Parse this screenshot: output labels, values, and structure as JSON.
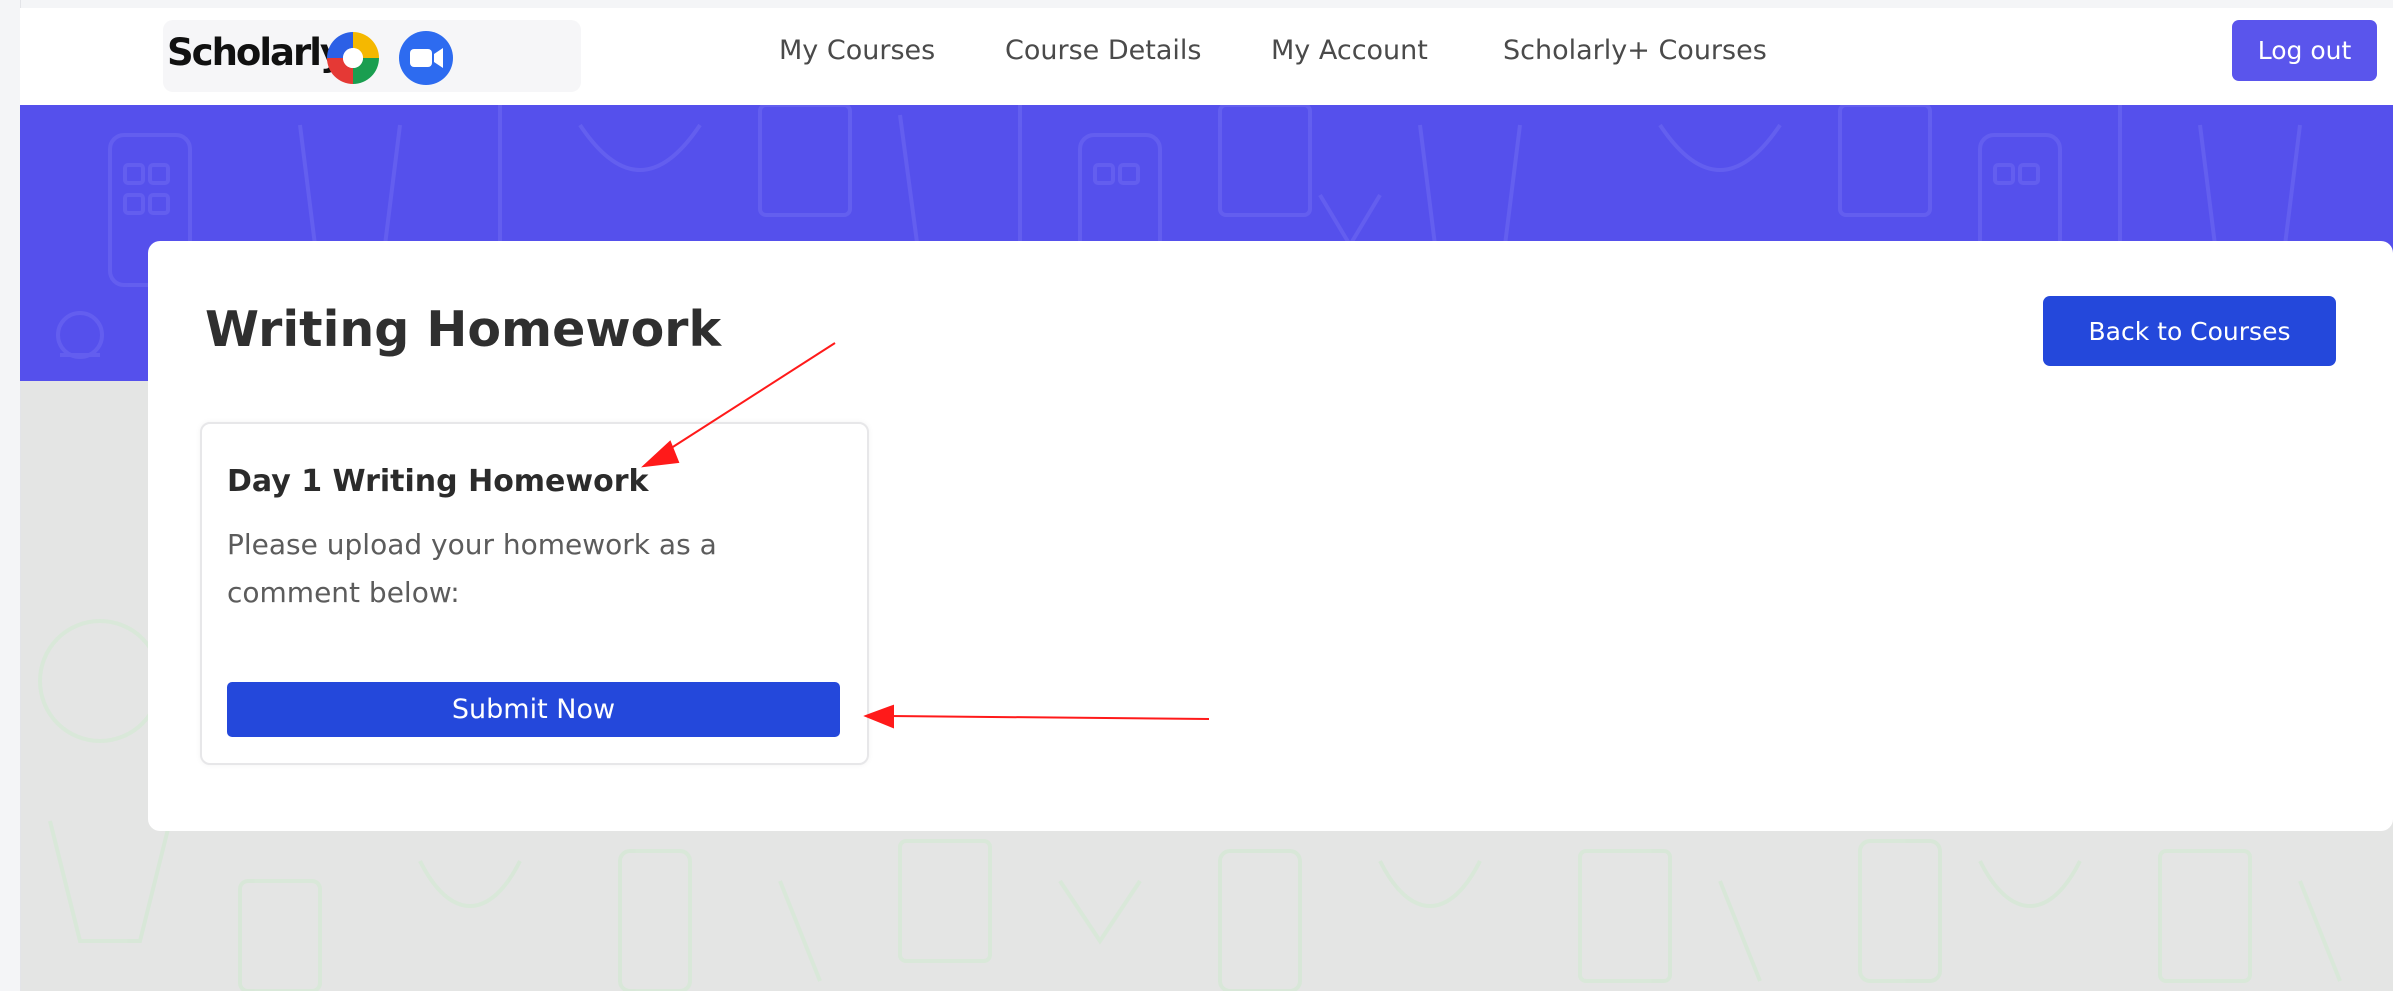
{
  "brand": {
    "name": "Scholarly",
    "ring_colors": [
      "#f5b800",
      "#1a9e50",
      "#e53935",
      "#2c60e6"
    ],
    "zoom_color": "#2d6bf0",
    "logo_icon": "scholarly-ring-icon",
    "zoom_icon": "zoom-camera-icon"
  },
  "nav": {
    "links": [
      {
        "label": "My Courses"
      },
      {
        "label": "Course Details"
      },
      {
        "label": "My Account"
      },
      {
        "label": "Scholarly+ Courses"
      }
    ],
    "logout_label": "Log out"
  },
  "colors": {
    "hero": "#5550ec",
    "primary_button": "#2448db",
    "logout_button": "#5a55ec",
    "annotation_arrow": "#ff1a1a"
  },
  "main": {
    "title": "Writing Homework",
    "back_label": "Back to Courses",
    "homework": {
      "title": "Day 1 Writing Homework",
      "description": "Please upload your homework as a comment below:",
      "submit_label": "Submit Now"
    }
  }
}
